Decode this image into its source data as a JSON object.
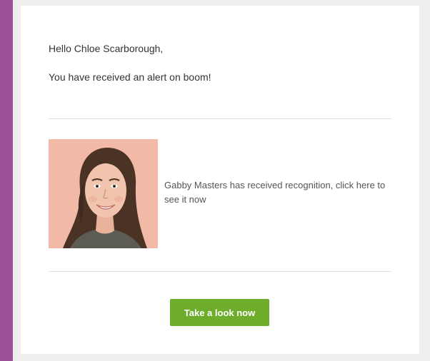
{
  "email": {
    "greeting": "Hello Chloe Scarborough,",
    "intro": "You have received an alert on boom!",
    "notification": {
      "text": "Gabby Masters has received recognition, click here to see it now",
      "photo_icon": "user-photo"
    },
    "cta_label": "Take a look now"
  },
  "colors": {
    "page_background": "#9b5298",
    "frame_background": "#eeeeee",
    "card_background": "#ffffff",
    "button": "#6eac2c",
    "photo_background": "#f2b9a7"
  }
}
